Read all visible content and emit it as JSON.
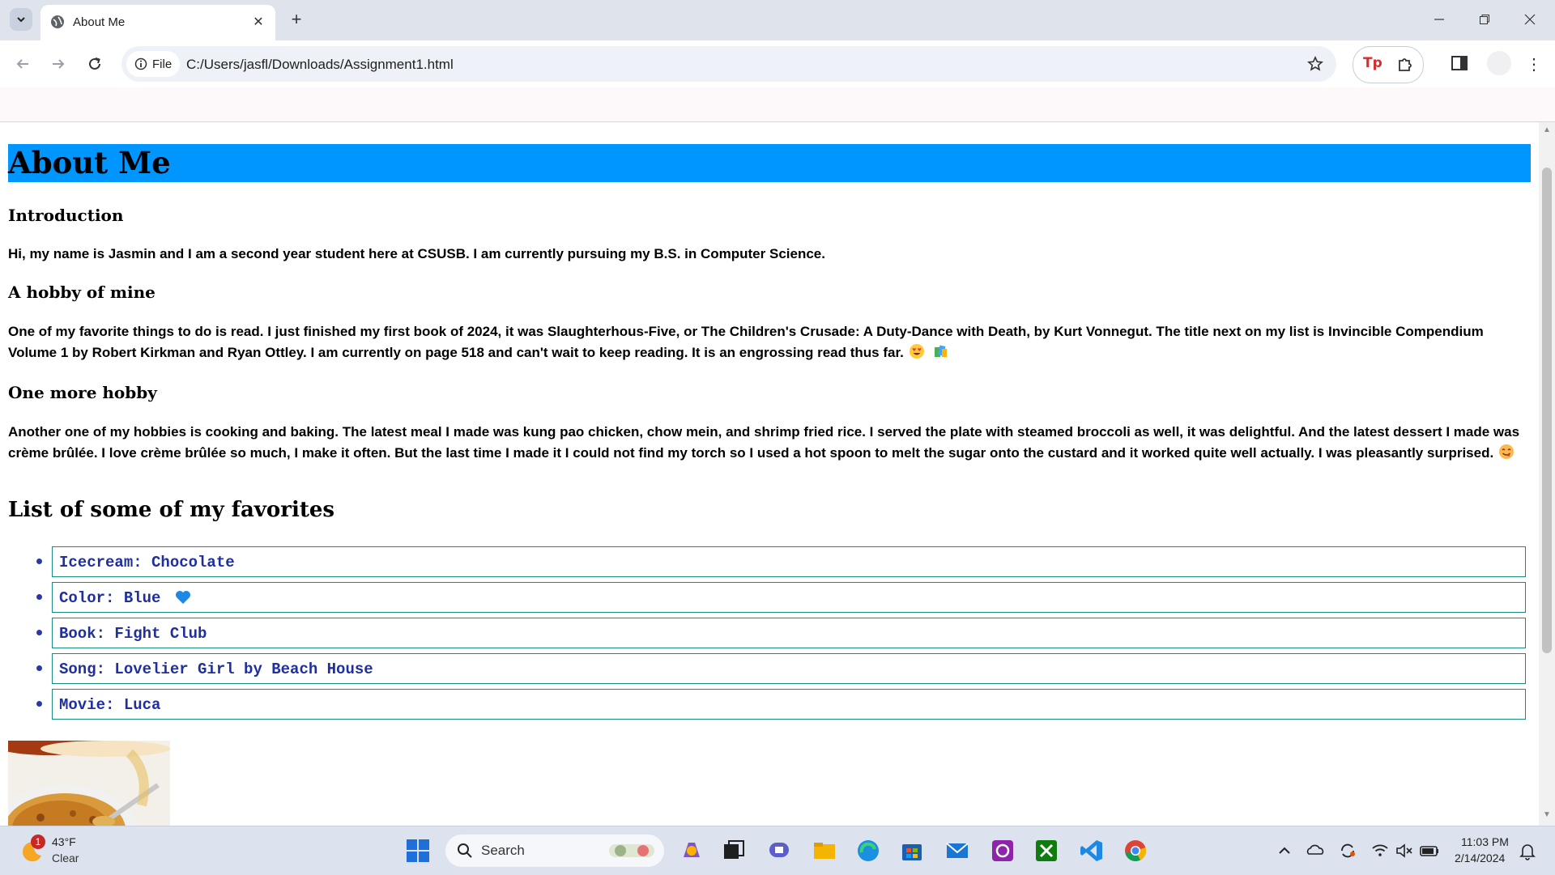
{
  "browser": {
    "tab_title": "About Me",
    "file_chip": "File",
    "url": "C:/Users/jasfl/Downloads/Assignment1.html",
    "extension_label": "Tp"
  },
  "page": {
    "title": "About Me",
    "sections": [
      {
        "heading": "Introduction",
        "text": "Hi, my name is Jasmin and I am a second year student here at CSUSB. I am currently pursuing my B.S. in Computer Science."
      },
      {
        "heading": "A hobby of mine",
        "text": "One of my favorite things to do is read. I just finished my first book of 2024, it was Slaughterhous-Five, or The Children's Crusade: A Duty-Dance with Death, by Kurt Vonnegut. The title next on my list is Invincible Compendium Volume 1 by Robert Kirkman and Ryan Ottley. I am currently on page 518 and can't wait to keep reading. It is an engrossing read thus far."
      },
      {
        "heading": "One more hobby",
        "text": "Another one of my hobbies is cooking and baking. The latest meal I made was kung pao chicken, chow mein, and shrimp fried rice. I served the plate with steamed broccoli as well, it was delightful. And the latest dessert I made was crème brûlée. I love crème brûlée so much, I make it often. But the last time I made it I could not find my torch so I used a hot spoon to melt the sugar onto the custard and it worked quite well actually. I was pleasantly surprised."
      }
    ],
    "favorites_heading": "List of some of my favorites",
    "favorites": [
      "Icecream: Chocolate",
      "Color: Blue",
      "Book: Fight Club",
      "Song: Lovelier Girl by Beach House",
      "Movie: Luca"
    ]
  },
  "taskbar": {
    "weather_badge": "1",
    "weather_temp": "43°F",
    "weather_desc": "Clear",
    "search_label": "Search",
    "time": "11:03 PM",
    "date": "2/14/2024"
  },
  "colors": {
    "heading_bar": "#0096ff",
    "list_border": "#1b8a80",
    "list_text": "#1f2f9e"
  }
}
